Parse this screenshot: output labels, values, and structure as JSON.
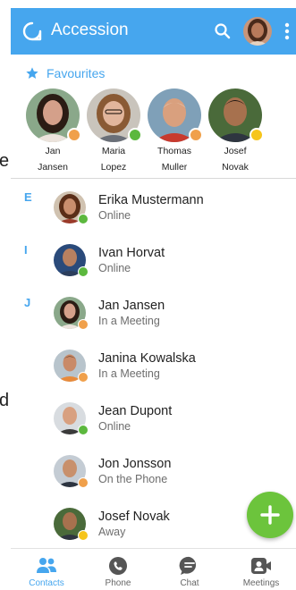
{
  "stray_letters": [
    "e",
    "d"
  ],
  "app_bar": {
    "title": "Accession",
    "color": "#46a6ee"
  },
  "favourites": {
    "label": "Favourites",
    "items": [
      {
        "first": "Jan",
        "last": "Jansen",
        "status": "meeting"
      },
      {
        "first": "Maria",
        "last": "Lopez",
        "status": "online"
      },
      {
        "first": "Thomas",
        "last": "Muller",
        "status": "busy"
      },
      {
        "first": "Josef",
        "last": "Novak",
        "status": "away"
      }
    ]
  },
  "contact_groups": [
    {
      "letter": "E",
      "contacts": [
        {
          "name": "Erika Mustermann",
          "status": "Online",
          "badge": "online"
        }
      ]
    },
    {
      "letter": "I",
      "contacts": [
        {
          "name": "Ivan Horvat",
          "status": "Online",
          "badge": "online"
        }
      ]
    },
    {
      "letter": "J",
      "contacts": [
        {
          "name": "Jan Jansen",
          "status": "In a Meeting",
          "badge": "meeting"
        },
        {
          "name": "Janina Kowalska",
          "status": "In a Meeting",
          "badge": "meeting"
        },
        {
          "name": "Jean Dupont",
          "status": "Online",
          "badge": "online"
        },
        {
          "name": "Jon Jonsson",
          "status": "On the Phone",
          "badge": "phone"
        },
        {
          "name": "Josef Novak",
          "status": "Away",
          "badge": "away"
        }
      ]
    }
  ],
  "bottom_nav": [
    {
      "label": "Contacts",
      "icon": "contacts-icon",
      "active": true
    },
    {
      "label": "Phone",
      "icon": "phone-icon",
      "active": false
    },
    {
      "label": "Chat",
      "icon": "chat-icon",
      "active": false
    },
    {
      "label": "Meetings",
      "icon": "meetings-icon",
      "active": false
    }
  ],
  "colors": {
    "accent": "#46a6ee",
    "online": "#5cb83e",
    "meeting": "#f0a04b",
    "busy": "#f0a04b",
    "away": "#f6c51b",
    "phone": "#f0a04b",
    "fab": "#6cc43c",
    "inactive_icon": "#555555"
  }
}
